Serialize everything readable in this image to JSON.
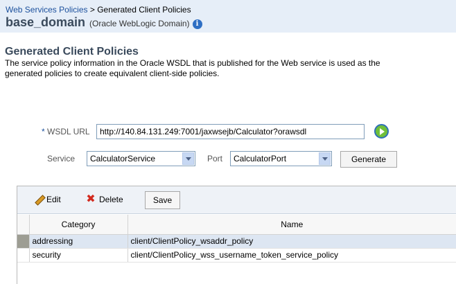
{
  "breadcrumb": {
    "link": "Web Services Policies",
    "separator": " > ",
    "current": "Generated Client Policies"
  },
  "domain": {
    "name": "base_domain",
    "type": "(Oracle WebLogic Domain)"
  },
  "page": {
    "title": "Generated Client Policies",
    "description_line1": "The service policy information in the Oracle WSDL that is published for the Web service is used as the",
    "description_line2": "generated policies to create equivalent client-side policies."
  },
  "form": {
    "required_marker": "*",
    "wsdl_label": "WSDL URL",
    "wsdl_value": "http://140.84.131.249:7001/jaxwsejb/Calculator?orawsdl",
    "service_label": "Service",
    "service_value": "CalculatorService",
    "port_label": "Port",
    "port_value": "CalculatorPort",
    "generate_label": "Generate"
  },
  "toolbar": {
    "edit_label": "Edit",
    "delete_label": "Delete",
    "save_label": "Save"
  },
  "table": {
    "headers": [
      "Category",
      "Name"
    ],
    "rows": [
      {
        "category": "addressing",
        "name": "client/ClientPolicy_wsaddr_policy"
      },
      {
        "category": "security",
        "name": "client/ClientPolicy_wss_username_token_service_policy"
      }
    ]
  },
  "icons": {
    "info": "info-icon",
    "go": "go-arrow-icon",
    "edit": "pencil-icon",
    "delete": "red-x-icon"
  }
}
